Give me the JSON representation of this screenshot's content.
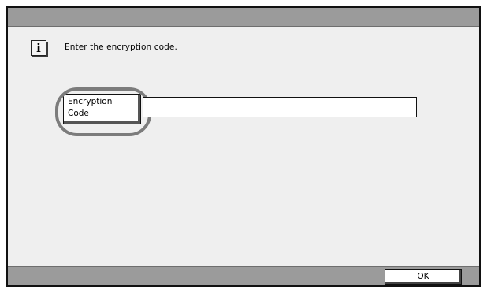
{
  "dialog": {
    "message": "Enter the encryption code.",
    "info_icon": "info-icon"
  },
  "encryption_code": {
    "label_line1": "Encryption",
    "label_line2": "Code",
    "value": ""
  },
  "footer": {
    "ok_label": "OK"
  }
}
